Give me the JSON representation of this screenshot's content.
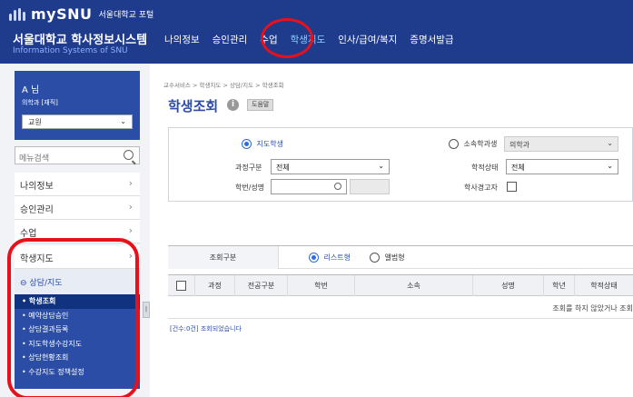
{
  "header": {
    "logo_text": "mySNU",
    "logo_sub": "서울대학교 포털",
    "system_title": "서울대학교 학사정보시스템",
    "system_subtitle": "Information Systems of SNU",
    "nav": [
      "나의정보",
      "승인관리",
      "수업",
      "학생지도",
      "인사/급여/복지",
      "증명서발급"
    ],
    "active_nav": "학생지도"
  },
  "sidebar": {
    "user_name": "A               님",
    "user_dept": "의학과 [재직]",
    "role_select": "교원",
    "search_placeholder": "메뉴검색",
    "items": [
      "나의정보",
      "승인관리",
      "수업",
      "학생지도"
    ],
    "sub_header": "⊖ 상담/지도",
    "sub_items": [
      "• 학생조회",
      "• 예약상담승인",
      "• 상담결과등록",
      "• 지도학생수강지도",
      "• 상담현황조회",
      "• 수강지도 정책설정"
    ],
    "active_sub": "• 학생조회"
  },
  "main": {
    "breadcrumb": "교수서비스 > 학생지도 > 상담/지도 > 학생조회",
    "title": "학생조회",
    "info_icon": "i",
    "help_label": "도움말",
    "filters": {
      "radio_advisee": "지도학생",
      "radio_dept": "소속학과생",
      "dept_select": "의학과",
      "course_label": "과정구분",
      "course_value": "전체",
      "status_label": "학적상태",
      "status_value": "전체",
      "id_label": "학번/성명",
      "warning_label": "학사경고자"
    },
    "view": {
      "label": "조회구분",
      "list_option": "리스트형",
      "album_option": "앨범형"
    },
    "table_headers": [
      "과정",
      "전공구분",
      "학번",
      "소속",
      "성명",
      "학년",
      "학적상태"
    ],
    "empty_message": "조회를 하지 않았거나 조회",
    "count_message": "[건수:0건] 조회되었습니다"
  }
}
